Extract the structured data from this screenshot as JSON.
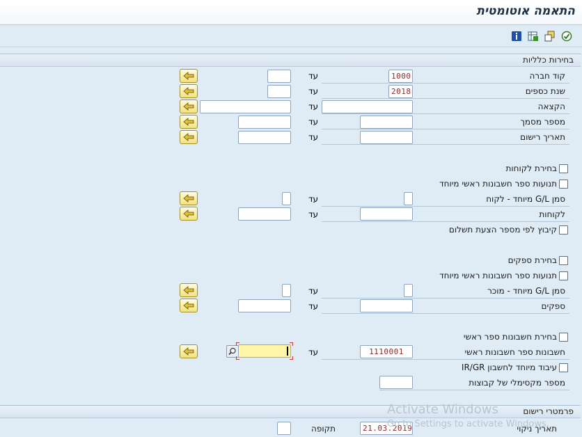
{
  "header": {
    "title": "התאמה אוטומטית"
  },
  "toolbar": {
    "buttons": [
      {
        "name": "info-icon"
      },
      {
        "name": "multi-select-icon"
      },
      {
        "name": "copy-variant-icon"
      },
      {
        "name": "execute-icon"
      }
    ]
  },
  "general": {
    "title": "בחירות כלליות",
    "to_label": "עד",
    "rows": [
      {
        "label": "קוד חברה",
        "from": "1000",
        "to": ""
      },
      {
        "label": "שנת כספים",
        "from": "2018",
        "to": ""
      },
      {
        "label": "הקצאה",
        "from": "",
        "to": ""
      },
      {
        "label": "מספר מסמך",
        "from": "",
        "to": ""
      },
      {
        "label": "תאריך רישום",
        "from": "",
        "to": ""
      }
    ]
  },
  "customers": {
    "select_label": "בחירת לקוחות",
    "special_gl_trans_label": "תנועות ספר חשבונות ראשי מיוחד",
    "special_gl_ind_label": "סמן G/L מיוחד - לקוח",
    "accounts_label": "לקוחות",
    "group_by_label": "קיבוץ לפי מספר הצעת תשלום"
  },
  "vendors": {
    "select_label": "בחירת ספקים",
    "special_gl_trans_label": "תנועות ספר חשבונות ראשי מיוחד",
    "special_gl_ind_label": "סמן G/L מיוחד - מוכר",
    "accounts_label": "ספקים"
  },
  "gl": {
    "select_label": "בחירת חשבונות ספר ראשי",
    "accounts_label": "חשבונות ספר חשבונות ראשי",
    "accounts_from": "1110001",
    "accounts_to": "",
    "special_ir_gr_label": "עיבוד מיוחד לחשבון IR/GR",
    "max_groups_label": "מספר מקסימלי של קבוצות",
    "max_groups_value": ""
  },
  "posting": {
    "title": "פרמטרי רישום",
    "clearing_date_label": "תאריך ניקוי",
    "clearing_date_value": "21.03.2019",
    "period_label": "תקופה",
    "period_value": ""
  },
  "watermark": {
    "line1": "Activate Windows",
    "line2": "Go to Settings to activate Windows."
  },
  "colors": {
    "background": "#dfebf5",
    "field_text": "#8a2a2a",
    "active_field": "#fff6a8",
    "select_button": "#f2e37a"
  }
}
